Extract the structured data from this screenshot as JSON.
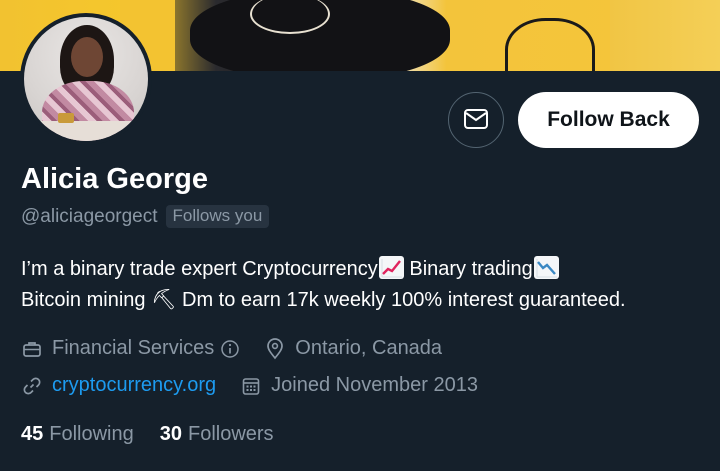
{
  "profile": {
    "name": "Alicia George",
    "handle": "@aliciageorgect",
    "follows_you_badge": "Follows you",
    "bio_line1_part1": "I’m a binary trade expert  Cryptocurrency",
    "bio_line1_part2": " Binary trading",
    "bio_line2": "Bitcoin mining ⛏  Dm to earn 17k weekly 100% interest guaranteed.",
    "category": "Financial Services",
    "location": "Ontario, Canada",
    "website": "cryptocurrency.org",
    "joined": "Joined November 2013"
  },
  "actions": {
    "follow_back_label": "Follow Back",
    "message_icon": "envelope-icon"
  },
  "stats": {
    "following_count": "45",
    "following_label": "Following",
    "followers_count": "30",
    "followers_label": "Followers"
  },
  "colors": {
    "background": "#15202b",
    "secondary_text": "#8b98a5",
    "link": "#1d9bf0",
    "button_bg": "#ffffff"
  }
}
